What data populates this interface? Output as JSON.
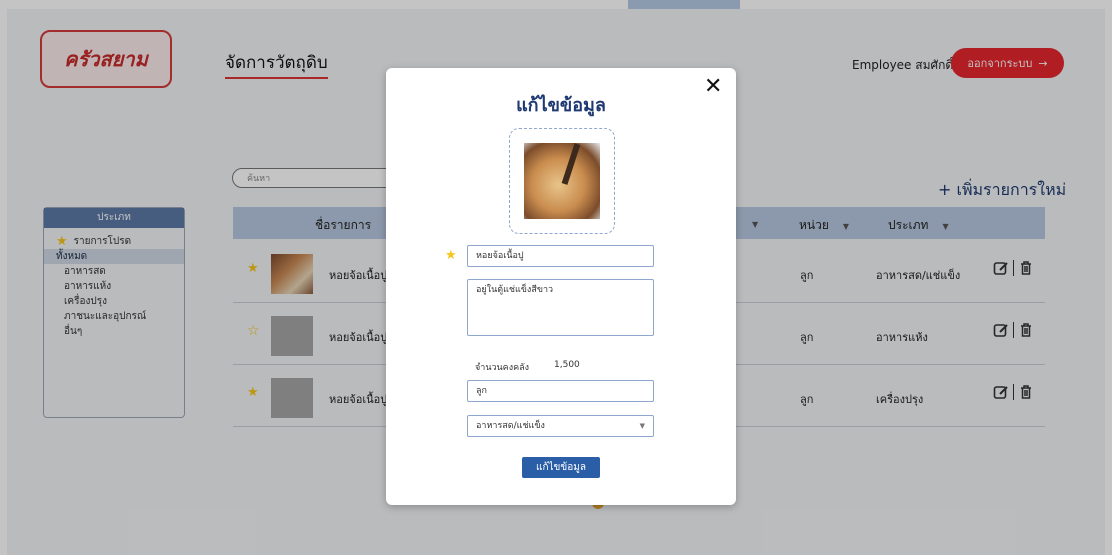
{
  "header": {
    "logo_text": "ครัวสยาม",
    "page_title": "จัดการวัตถุดิบ",
    "employee": "Employee สมศักดิ์",
    "logout_label": "ออกจากระบบ",
    "logout_arrow": "→"
  },
  "toolbar": {
    "search_placeholder": "ค้นหา",
    "add_new": "+ เพิ่มรายการใหม่"
  },
  "categories": {
    "title": "ประเภท",
    "favorites": "รายการโปรด",
    "all": "ทั้งหมด",
    "items": [
      "อาหารสด",
      "อาหารแห้ง",
      "เครื่องปรุง",
      "ภาชนะและอุปกรณ์",
      "อื่นๆ"
    ]
  },
  "table": {
    "headers": {
      "name": "ชื่อรายการ",
      "unit": "หน่วย",
      "type": "ประเภท"
    },
    "rows": [
      {
        "name": "หอยจ้อเนื้อปู",
        "unit": "ลูก",
        "type": "อาหารสด/แช่แข็ง",
        "favorite": true
      },
      {
        "name": "หอยจ้อเนื้อปู",
        "unit": "ลูก",
        "type": "อาหารแห้ง",
        "favorite": false
      },
      {
        "name": "หอยจ้อเนื้อปู",
        "unit": "ลูก",
        "type": "เครื่องปรุง",
        "favorite": true
      }
    ]
  },
  "modal": {
    "title": "แก้ไขข้อมูล",
    "close": "✕",
    "name_value": "หอยจ้อเนื้อปู",
    "description_value": "อยู่ในตู้แช่แข็งสีขาว",
    "stock_label": "จำนวนคงคลัง",
    "stock_value": "1,500",
    "unit_value": "ลูก",
    "type_value": "อาหารสด/แช่แข็ง",
    "save_label": "แก้ไขข้อมูล"
  },
  "colors": {
    "brand_red": "#e5262e",
    "primary_blue": "#2a5fa8",
    "header_blue": "#b7c8e0",
    "favorite_star": "#f5c518"
  }
}
